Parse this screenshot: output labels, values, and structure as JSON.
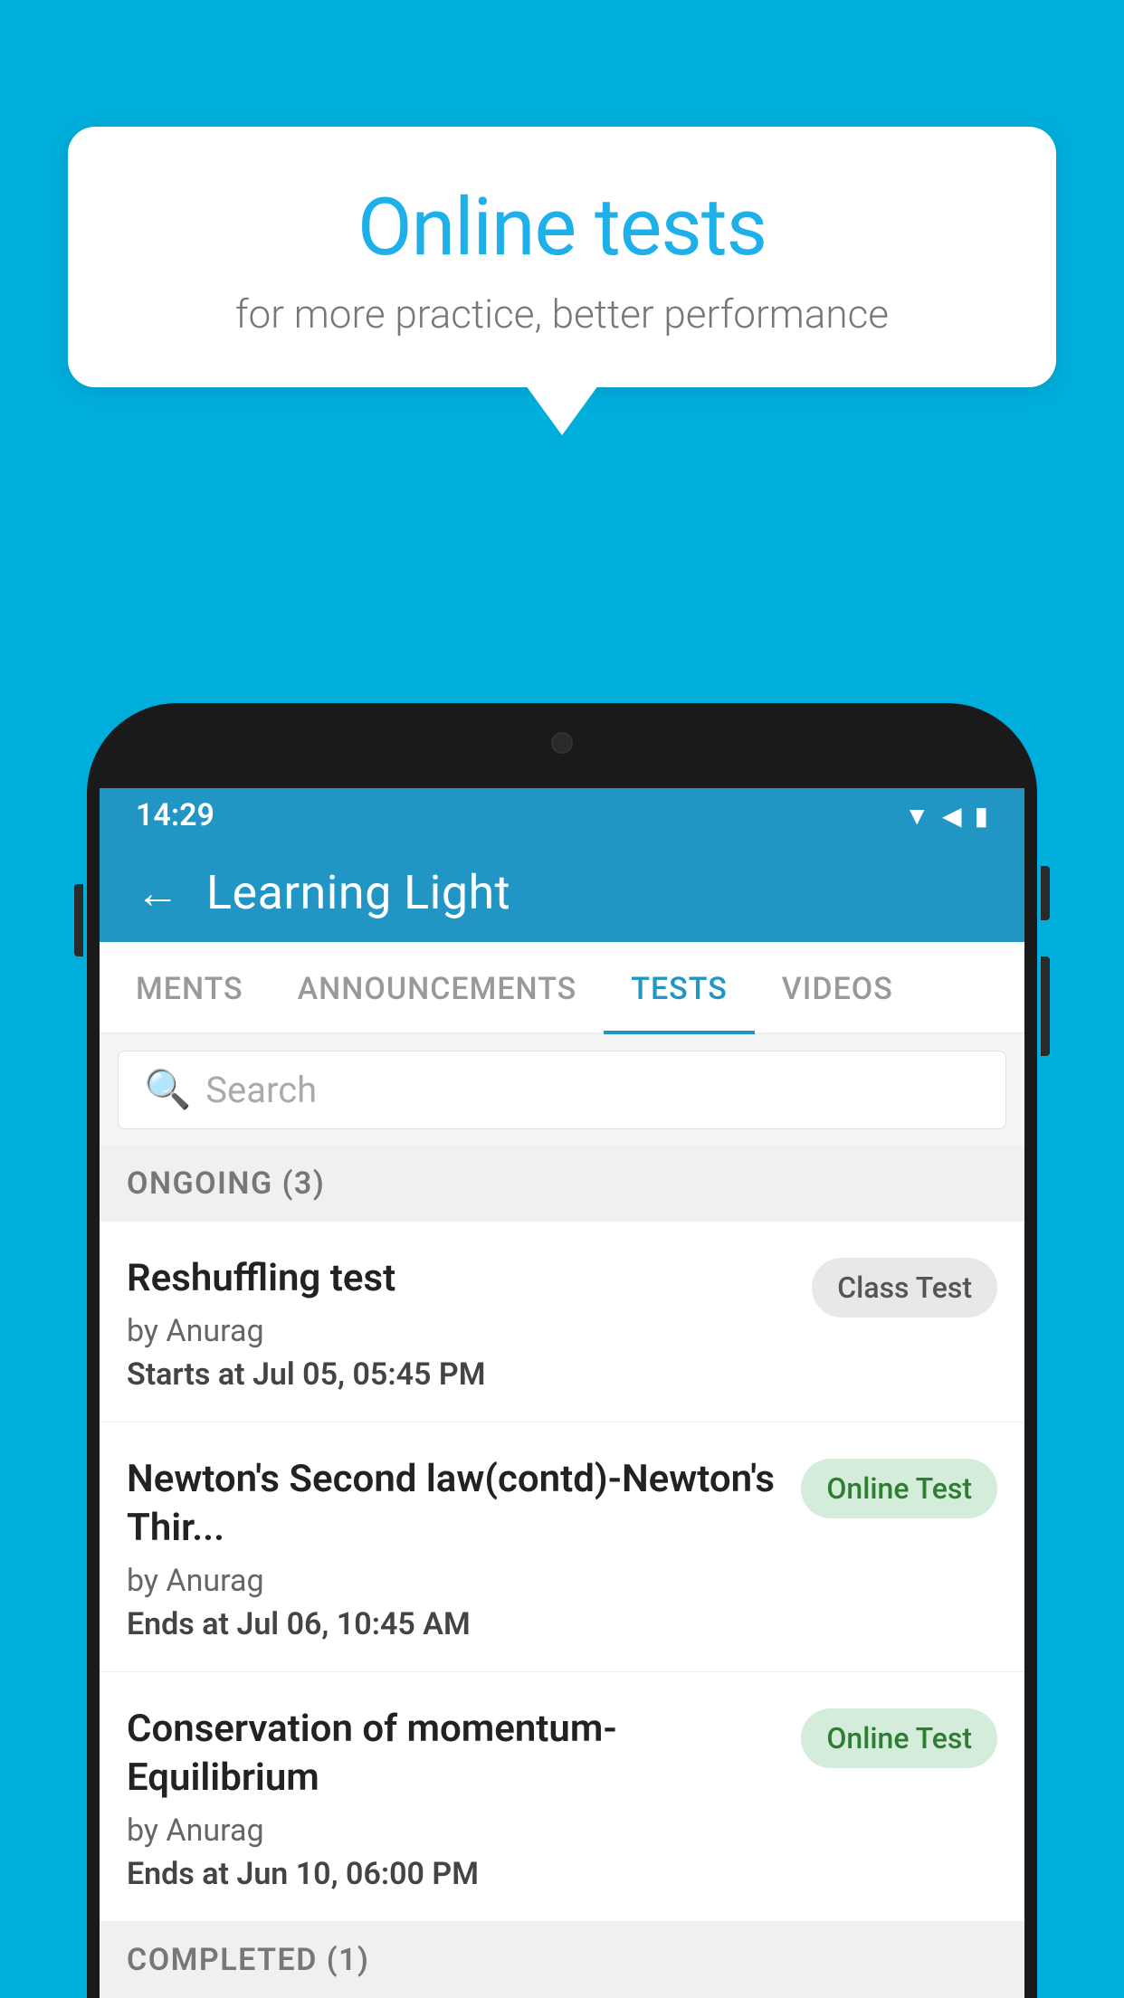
{
  "background_color": "#00AEDB",
  "speech_bubble": {
    "title": "Online tests",
    "subtitle": "for more practice, better performance"
  },
  "status_bar": {
    "time": "14:29",
    "icons": [
      "wifi",
      "signal",
      "battery"
    ]
  },
  "app_header": {
    "title": "Learning Light",
    "back_label": "←"
  },
  "tabs": [
    {
      "label": "MENTS",
      "active": false
    },
    {
      "label": "ANNOUNCEMENTS",
      "active": false
    },
    {
      "label": "TESTS",
      "active": true
    },
    {
      "label": "VIDEOS",
      "active": false
    }
  ],
  "search": {
    "placeholder": "Search"
  },
  "sections": [
    {
      "title": "ONGOING (3)",
      "items": [
        {
          "title": "Reshuffling test",
          "author": "by Anurag",
          "date_label": "Starts at",
          "date_value": "Jul 05, 05:45 PM",
          "badge": "Class Test",
          "badge_type": "class"
        },
        {
          "title": "Newton's Second law(contd)-Newton's Thir...",
          "author": "by Anurag",
          "date_label": "Ends at",
          "date_value": "Jul 06, 10:45 AM",
          "badge": "Online Test",
          "badge_type": "online"
        },
        {
          "title": "Conservation of momentum-Equilibrium",
          "author": "by Anurag",
          "date_label": "Ends at",
          "date_value": "Jun 10, 06:00 PM",
          "badge": "Online Test",
          "badge_type": "online"
        }
      ]
    },
    {
      "title": "COMPLETED (1)",
      "items": []
    }
  ]
}
